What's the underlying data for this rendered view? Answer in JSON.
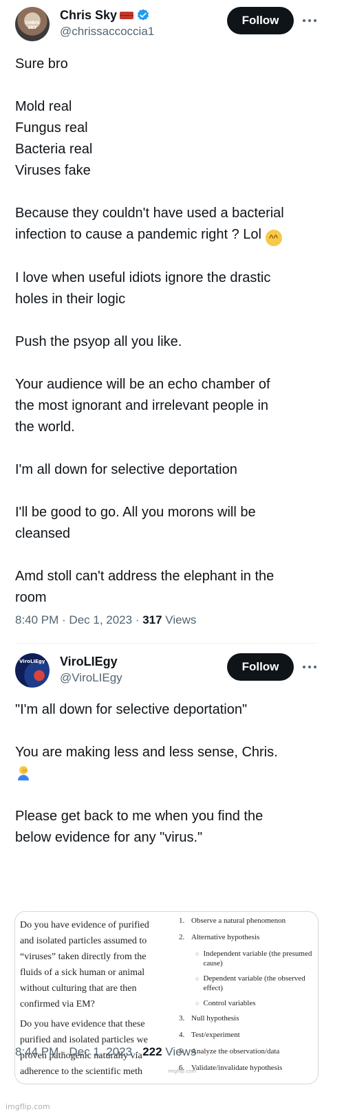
{
  "tweet1": {
    "display_name": "Chris Sky",
    "handle": "@chrissaccoccia1",
    "avatar_text": "CHRIS SKY",
    "follow_label": "Follow",
    "paragraphs": [
      [
        "Sure bro"
      ],
      [
        "Mold real",
        "Fungus real",
        "Bacteria real",
        "Viruses fake"
      ],
      [
        "Because they couldn't have used a bacterial",
        "infection to cause a pandemic right ? Lol"
      ],
      [
        "I love when useful idiots ignore the drastic",
        "holes in their logic"
      ],
      [
        "Push the psyop all you like."
      ],
      [
        "Your audience will be an echo chamber of",
        "the most ignorant and irrelevant people in",
        "the world."
      ],
      [
        "I'm all down for selective deportation"
      ],
      [
        "I'll be good to go. All you morons will be",
        "cleansed"
      ],
      [
        "Amd stoll can't address the elephant in the",
        "room"
      ]
    ],
    "time": "8:40 PM · Dec 1, 2023 · ",
    "views_count": "317",
    "views_label": " Views"
  },
  "tweet2": {
    "display_name": "ViroLIEgy",
    "handle": "@ViroLIEgy",
    "avatar_text": "ViroLIEgy",
    "follow_label": "Follow",
    "quote": "\"I'm all down for selective deportation\"",
    "line2": "You are making less and less sense, Chris.",
    "line3a": "Please get back to me when you find the",
    "line3b": "below evidence for any \"virus.\"",
    "time": "8:44 PM · Dec 1, 2023 · ",
    "views_count": "222",
    "views_label": " Views"
  },
  "media": {
    "left_lines_1": [
      "Do you have evidence of purified",
      "and isolated particles assumed to",
      "“viruses” taken directly from the",
      "fluids of a sick human or animal",
      "without culturing that are then",
      "confirmed via EM?"
    ],
    "left_lines_2": [
      "Do you have evidence that these",
      "purified and isolated particles we",
      "proven pathogenic naturally via",
      "adherence to the scientific meth"
    ],
    "steps": [
      {
        "n": "1.",
        "text": "Observe a natural phenomenon"
      },
      {
        "n": "2.",
        "text": "Alternative hypothesis"
      },
      {
        "n": "3.",
        "text": "Null hypothesis"
      },
      {
        "n": "4.",
        "text": "Test/experiment"
      },
      {
        "n": "5.",
        "text": "Analyze the observation/data"
      },
      {
        "n": "6.",
        "text": "Validate/invalidate hypothesis"
      }
    ],
    "subs": [
      "Independent variable (the presumed cause)",
      "Dependent variable (the observed effect)",
      "Control variables"
    ],
    "small_watermark": "imgflip.com"
  },
  "watermark": "imgflip.com",
  "icons": {
    "verified": "verified-badge-icon",
    "brick": "brick-emoji-icon",
    "more": "more-icon",
    "laugh": "laughing-emoji-icon",
    "facepalm": "facepalm-emoji-icon"
  },
  "colors": {
    "text": "#0f1419",
    "secondary": "#536471",
    "verified": "#1d9bf0",
    "button": "#0f1419"
  }
}
